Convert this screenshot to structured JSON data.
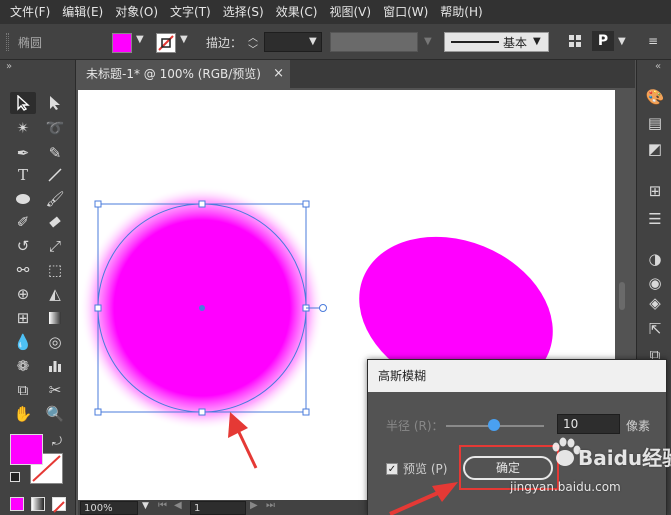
{
  "menu": [
    "文件(F)",
    "编辑(E)",
    "对象(O)",
    "文字(T)",
    "选择(S)",
    "效果(C)",
    "视图(V)",
    "窗口(W)",
    "帮助(H)"
  ],
  "control_bar": {
    "object_type": "椭圆",
    "fill_color": "#ff00ff",
    "stroke_label": "描边：",
    "brush_label": "基本"
  },
  "tab": {
    "title": "未标题-1* @ 100% (RGB/预览)",
    "close": "×"
  },
  "status": {
    "zoom": "100%",
    "page": "1"
  },
  "artwork": {
    "blurred_circle_color": "#ff00ff",
    "ellipse_color": "#ff00ff",
    "selection_color": "#4a7bdb",
    "arrow_color": "#e53935"
  },
  "dialog": {
    "title": "高斯模糊",
    "radius_label": "半径 (R)：",
    "radius_value": "10",
    "radius_fraction": 0.4,
    "unit": "像素",
    "preview_label": "预览 (P)",
    "preview_checked": true,
    "check_mark": "✓",
    "ok_label": "确定"
  },
  "watermark": {
    "brand": "Baidu经验",
    "url": "jingyan.baidu.com"
  },
  "icons": {
    "close": "×",
    "chevron": "⌄",
    "collapse_left": "«",
    "collapse_right": "»"
  }
}
